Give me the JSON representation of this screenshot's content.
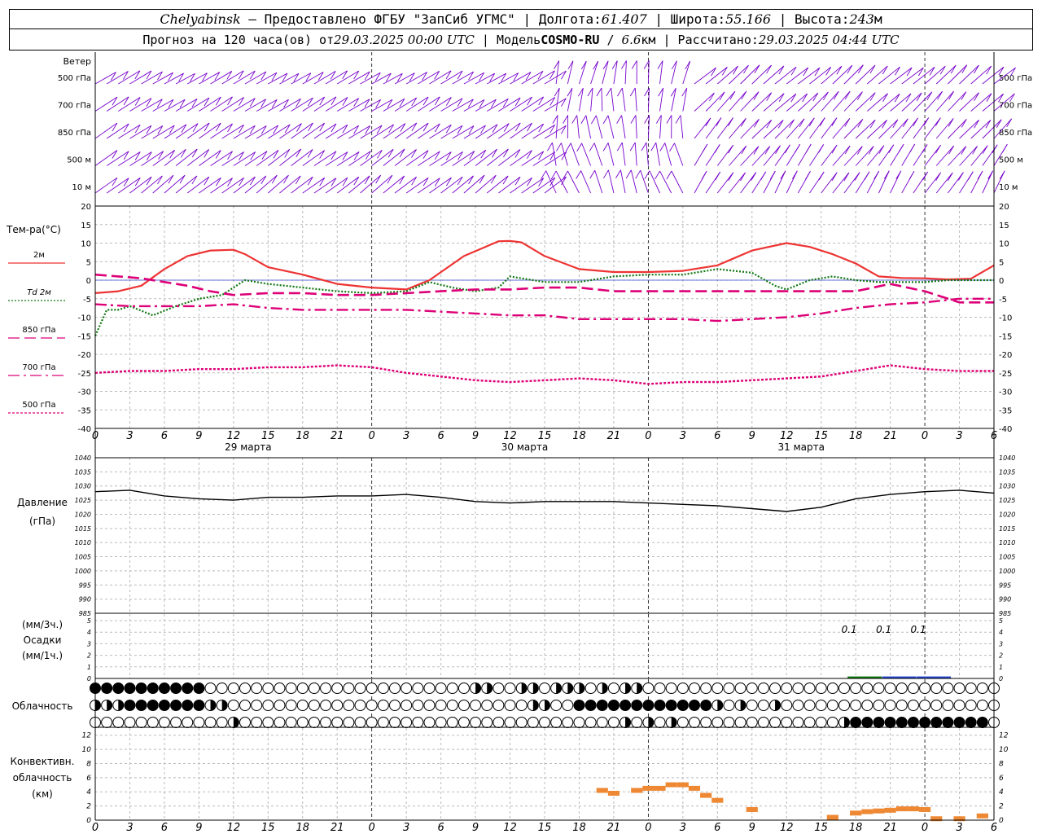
{
  "header": {
    "city": "Chelyabinsk",
    "dash": " — ",
    "provider": "Предоставлено ФГБУ \"ЗапСиб УГМС\"",
    "lon_label": "Долгота:",
    "lon": "61.407",
    "lat_label": "Широта:",
    "lat": "55.166",
    "alt_label": "Высота:",
    "alt": "243",
    "alt_unit": "м",
    "sep": " | ",
    "forecast_label": "Прогноз на 120 часа(ов) от",
    "forecast_time": "29.03.2025 00:00 UTC",
    "model_label": "Модель",
    "model": "COSMO-RU",
    "resolution": "6.6",
    "res_unit": "км",
    "calc_label": "Рассчитано:",
    "calc_time": "29.03.2025 04:44 UTC"
  },
  "wind": {
    "title": "Ветер",
    "levels": [
      "500 гПа",
      "700 гПа",
      "850 гПа",
      "500 м",
      "10 м"
    ]
  },
  "temp_panel": {
    "title": "Тем-ра(°C)",
    "legend": [
      {
        "label": "2м",
        "color": "#ee3333",
        "style": "solid"
      },
      {
        "label": "Td 2м",
        "color": "#117711",
        "style": "dotted"
      },
      {
        "label": "850 гПа",
        "color": "#dd0077",
        "style": "dash"
      },
      {
        "label": "700 гПа",
        "color": "#dd0077",
        "style": "dashdot"
      },
      {
        "label": "500 гПа",
        "color": "#dd0077",
        "style": "dot"
      }
    ]
  },
  "pressure_panel": {
    "title": "Давление",
    "unit": "(гПа)"
  },
  "precip_panel": {
    "unit1": "(мм/3ч.)",
    "title": "Осадки",
    "unit2": "(мм/1ч.)"
  },
  "cloud_panel": {
    "title": "Облачность"
  },
  "conv_panel": {
    "title1": "Конвективн.",
    "title2": "облачность",
    "unit": "(км)"
  },
  "chart_data": {
    "type": "line",
    "hours": [
      0,
      3,
      6,
      9,
      12,
      15,
      18,
      21,
      24,
      27,
      30,
      33,
      36,
      39,
      42,
      45,
      48,
      51,
      54,
      57,
      60,
      63,
      66,
      69,
      72,
      75,
      78
    ],
    "hour_tick_labels": [
      "0",
      "3",
      "6",
      "9",
      "12",
      "15",
      "18",
      "21",
      "0",
      "3",
      "6",
      "9",
      "12",
      "15",
      "18",
      "21",
      "0",
      "3",
      "6",
      "9",
      "12",
      "15",
      "18",
      "21",
      "0",
      "3",
      "6"
    ],
    "day_labels": [
      {
        "hour": 12,
        "label": "29 марта"
      },
      {
        "hour": 36,
        "label": "30 марта"
      },
      {
        "hour": 60,
        "label": "31 марта"
      }
    ],
    "temperature": {
      "ylim": [
        -40,
        20
      ],
      "ticks": [
        20,
        15,
        10,
        5,
        0,
        -5,
        -10,
        -15,
        -20,
        -25,
        -30,
        -35,
        -40
      ],
      "series": [
        {
          "name": "2м",
          "color": "#ee3333",
          "x": [
            0,
            2,
            4,
            6,
            8,
            10,
            12,
            13,
            15,
            18,
            21,
            24,
            27,
            29,
            32,
            35,
            36,
            37,
            39,
            42,
            45,
            48,
            51,
            54,
            57,
            60,
            62,
            64,
            66,
            68,
            70,
            72,
            74,
            76,
            78
          ],
          "values": [
            -3.5,
            -3,
            -1.5,
            3,
            6.5,
            8,
            8.2,
            7,
            3.5,
            1.5,
            -1,
            -2,
            -2.5,
            0,
            6.5,
            10.5,
            10.6,
            10.2,
            6.5,
            3,
            2.2,
            2.2,
            2.5,
            4,
            8,
            10,
            9,
            7,
            4.5,
            1,
            0.6,
            0.5,
            0.2,
            0.4,
            4
          ]
        },
        {
          "name": "Td 2м",
          "color": "#117711",
          "x": [
            0,
            1,
            2,
            3,
            5,
            7,
            9,
            11,
            13,
            15,
            18,
            21,
            24,
            27,
            29,
            31,
            33,
            35,
            36,
            37,
            39,
            42,
            45,
            48,
            51,
            54,
            57,
            59,
            60,
            62,
            64,
            66,
            68,
            70,
            72,
            74,
            76,
            78
          ],
          "values": [
            -15,
            -8,
            -8,
            -7,
            -9.5,
            -7,
            -5,
            -4,
            0,
            -1,
            -2,
            -3,
            -3.5,
            -3,
            -0.5,
            -2,
            -3,
            -2,
            1,
            0.5,
            -0.5,
            -0.5,
            1,
            1.5,
            1.5,
            3,
            2,
            -1.5,
            -2.5,
            0,
            1,
            0,
            -0.5,
            -0.5,
            -0.5,
            0,
            0,
            0
          ]
        },
        {
          "name": "850 гПа",
          "color": "#dd0077",
          "x": [
            0,
            2,
            4,
            6,
            8,
            10,
            12,
            15,
            18,
            21,
            24,
            27,
            30,
            33,
            36,
            39,
            42,
            45,
            48,
            51,
            54,
            57,
            60,
            63,
            66,
            69,
            72,
            75,
            78
          ],
          "values": [
            1.5,
            1,
            0.5,
            -0.5,
            -1.5,
            -3,
            -4,
            -3.5,
            -3.5,
            -4,
            -4,
            -3.5,
            -3,
            -2.5,
            -2.5,
            -2,
            -2,
            -3,
            -3,
            -3,
            -3,
            -3,
            -3,
            -3,
            -3,
            -1,
            -3,
            -6,
            -6
          ]
        },
        {
          "name": "700 гПа",
          "color": "#dd0077",
          "x": [
            0,
            3,
            6,
            9,
            12,
            15,
            18,
            21,
            24,
            27,
            30,
            33,
            36,
            39,
            42,
            45,
            48,
            51,
            54,
            57,
            60,
            63,
            66,
            69,
            72,
            75,
            78
          ],
          "values": [
            -6.5,
            -7,
            -7,
            -7,
            -6.5,
            -7.5,
            -8,
            -8,
            -8,
            -8,
            -8.5,
            -9,
            -9.5,
            -9.5,
            -10.5,
            -10.5,
            -10.5,
            -10.5,
            -11,
            -10.5,
            -10,
            -9,
            -7.5,
            -6.5,
            -6,
            -5,
            -5
          ]
        },
        {
          "name": "500 гПа",
          "color": "#dd0077",
          "x": [
            0,
            3,
            6,
            9,
            12,
            15,
            18,
            21,
            24,
            27,
            30,
            33,
            36,
            39,
            42,
            45,
            48,
            51,
            54,
            57,
            60,
            63,
            66,
            69,
            72,
            75,
            78
          ],
          "values": [
            -25,
            -24.5,
            -24.5,
            -24,
            -24,
            -23.5,
            -23.5,
            -23,
            -23.5,
            -25,
            -26,
            -27,
            -27.5,
            -27,
            -26.5,
            -27,
            -28,
            -27.5,
            -27.5,
            -27,
            -26.5,
            -26,
            -24.5,
            -23,
            -24,
            -24.5,
            -24.5
          ]
        }
      ]
    },
    "pressure": {
      "ylim": [
        985,
        1040
      ],
      "ticks": [
        1040,
        1035,
        1030,
        1025,
        1020,
        1015,
        1010,
        1005,
        1000,
        995,
        990,
        985
      ],
      "x": [
        0,
        3,
        6,
        9,
        12,
        15,
        18,
        21,
        24,
        27,
        30,
        33,
        36,
        39,
        42,
        45,
        48,
        51,
        54,
        57,
        60,
        63,
        66,
        69,
        72,
        75,
        78
      ],
      "values": [
        1028,
        1028.5,
        1026.5,
        1025.5,
        1025,
        1026,
        1026,
        1026.5,
        1026.5,
        1027,
        1026,
        1024.5,
        1024,
        1024.5,
        1024.5,
        1024.5,
        1024,
        1023.5,
        1023,
        1022,
        1021,
        1022.5,
        1025.5,
        1027,
        1028,
        1028.5,
        1027.5
      ]
    },
    "precipitation": {
      "ylim": [
        0,
        5
      ],
      "ticks": [
        5,
        4,
        3,
        2,
        1,
        0
      ],
      "bars": [
        {
          "hour": 66,
          "value": 0.1,
          "label": "0.1",
          "color": "#117711"
        },
        {
          "hour": 69,
          "value": 0.1,
          "label": "0.1",
          "color": "#2244cc"
        },
        {
          "hour": 72,
          "value": 0.1,
          "label": "0.1",
          "color": "#2244cc"
        }
      ]
    },
    "cloudiness": {
      "rows": [
        {
          "level": "upper",
          "full_hours": [
            0,
            1,
            2,
            3,
            4,
            5,
            6,
            7,
            8,
            9
          ],
          "partial_hours": [
            33,
            34,
            37,
            38,
            40,
            41,
            42,
            44,
            46,
            47
          ]
        },
        {
          "level": "middle",
          "full_hours": [
            3,
            4,
            5,
            6,
            7,
            8,
            9,
            42,
            43,
            44,
            45,
            46,
            47,
            48,
            49,
            50,
            51,
            52,
            53
          ],
          "partial_hours": [
            0,
            1,
            2,
            10,
            11,
            38,
            39,
            54,
            56,
            59
          ]
        },
        {
          "level": "lower",
          "full_hours": [
            66,
            67,
            68,
            69,
            70,
            71,
            72,
            73,
            74,
            75,
            76,
            77
          ],
          "partial_hours": [
            12,
            46,
            48,
            50,
            65
          ]
        }
      ]
    },
    "convective": {
      "ylim": [
        0,
        13
      ],
      "ticks": [
        12,
        10,
        8,
        6,
        4,
        2,
        0
      ],
      "bars": [
        {
          "hour": 44,
          "value": 4.2
        },
        {
          "hour": 45,
          "value": 3.8
        },
        {
          "hour": 47,
          "value": 4.2
        },
        {
          "hour": 48,
          "value": 4.5
        },
        {
          "hour": 49,
          "value": 4.5
        },
        {
          "hour": 50,
          "value": 5
        },
        {
          "hour": 51,
          "value": 5
        },
        {
          "hour": 52,
          "value": 4.5
        },
        {
          "hour": 53,
          "value": 3.5
        },
        {
          "hour": 54,
          "value": 2.8
        },
        {
          "hour": 57,
          "value": 1.5
        },
        {
          "hour": 64,
          "value": 0.4
        },
        {
          "hour": 66,
          "value": 1
        },
        {
          "hour": 67,
          "value": 1.2
        },
        {
          "hour": 68,
          "value": 1.3
        },
        {
          "hour": 69,
          "value": 1.4
        },
        {
          "hour": 70,
          "value": 1.6
        },
        {
          "hour": 71,
          "value": 1.6
        },
        {
          "hour": 72,
          "value": 1.5
        },
        {
          "hour": 73,
          "value": 0.2
        },
        {
          "hour": 75,
          "value": 0.2
        },
        {
          "hour": 77,
          "value": 0.6
        }
      ],
      "color": "#ee8833"
    }
  },
  "colors": {
    "wind": "#7700cc",
    "grid": "#bbbbbb",
    "axis": "#000000"
  }
}
